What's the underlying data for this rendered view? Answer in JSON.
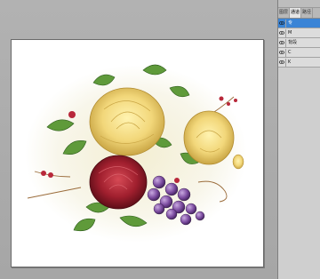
{
  "app": {
    "accent": "#3a84d6"
  },
  "panel": {
    "tabs": [
      {
        "label": "图层",
        "active": false
      },
      {
        "label": "通道",
        "active": true
      },
      {
        "label": "路径",
        "active": false
      }
    ],
    "channels": [
      {
        "label": "专",
        "selected": true,
        "icon": "eye-icon"
      },
      {
        "label": "M",
        "selected": false,
        "icon": "eye-icon"
      },
      {
        "label": "背段",
        "selected": false,
        "icon": "eye-icon"
      },
      {
        "label": "C",
        "selected": false,
        "icon": "eye-icon"
      },
      {
        "label": "K",
        "selected": false,
        "icon": "eye-icon"
      },
      {
        "label": "白",
        "selected": false,
        "icon": "eye-icon"
      }
    ]
  },
  "canvas": {
    "content": "floral-bouquet-artwork"
  }
}
